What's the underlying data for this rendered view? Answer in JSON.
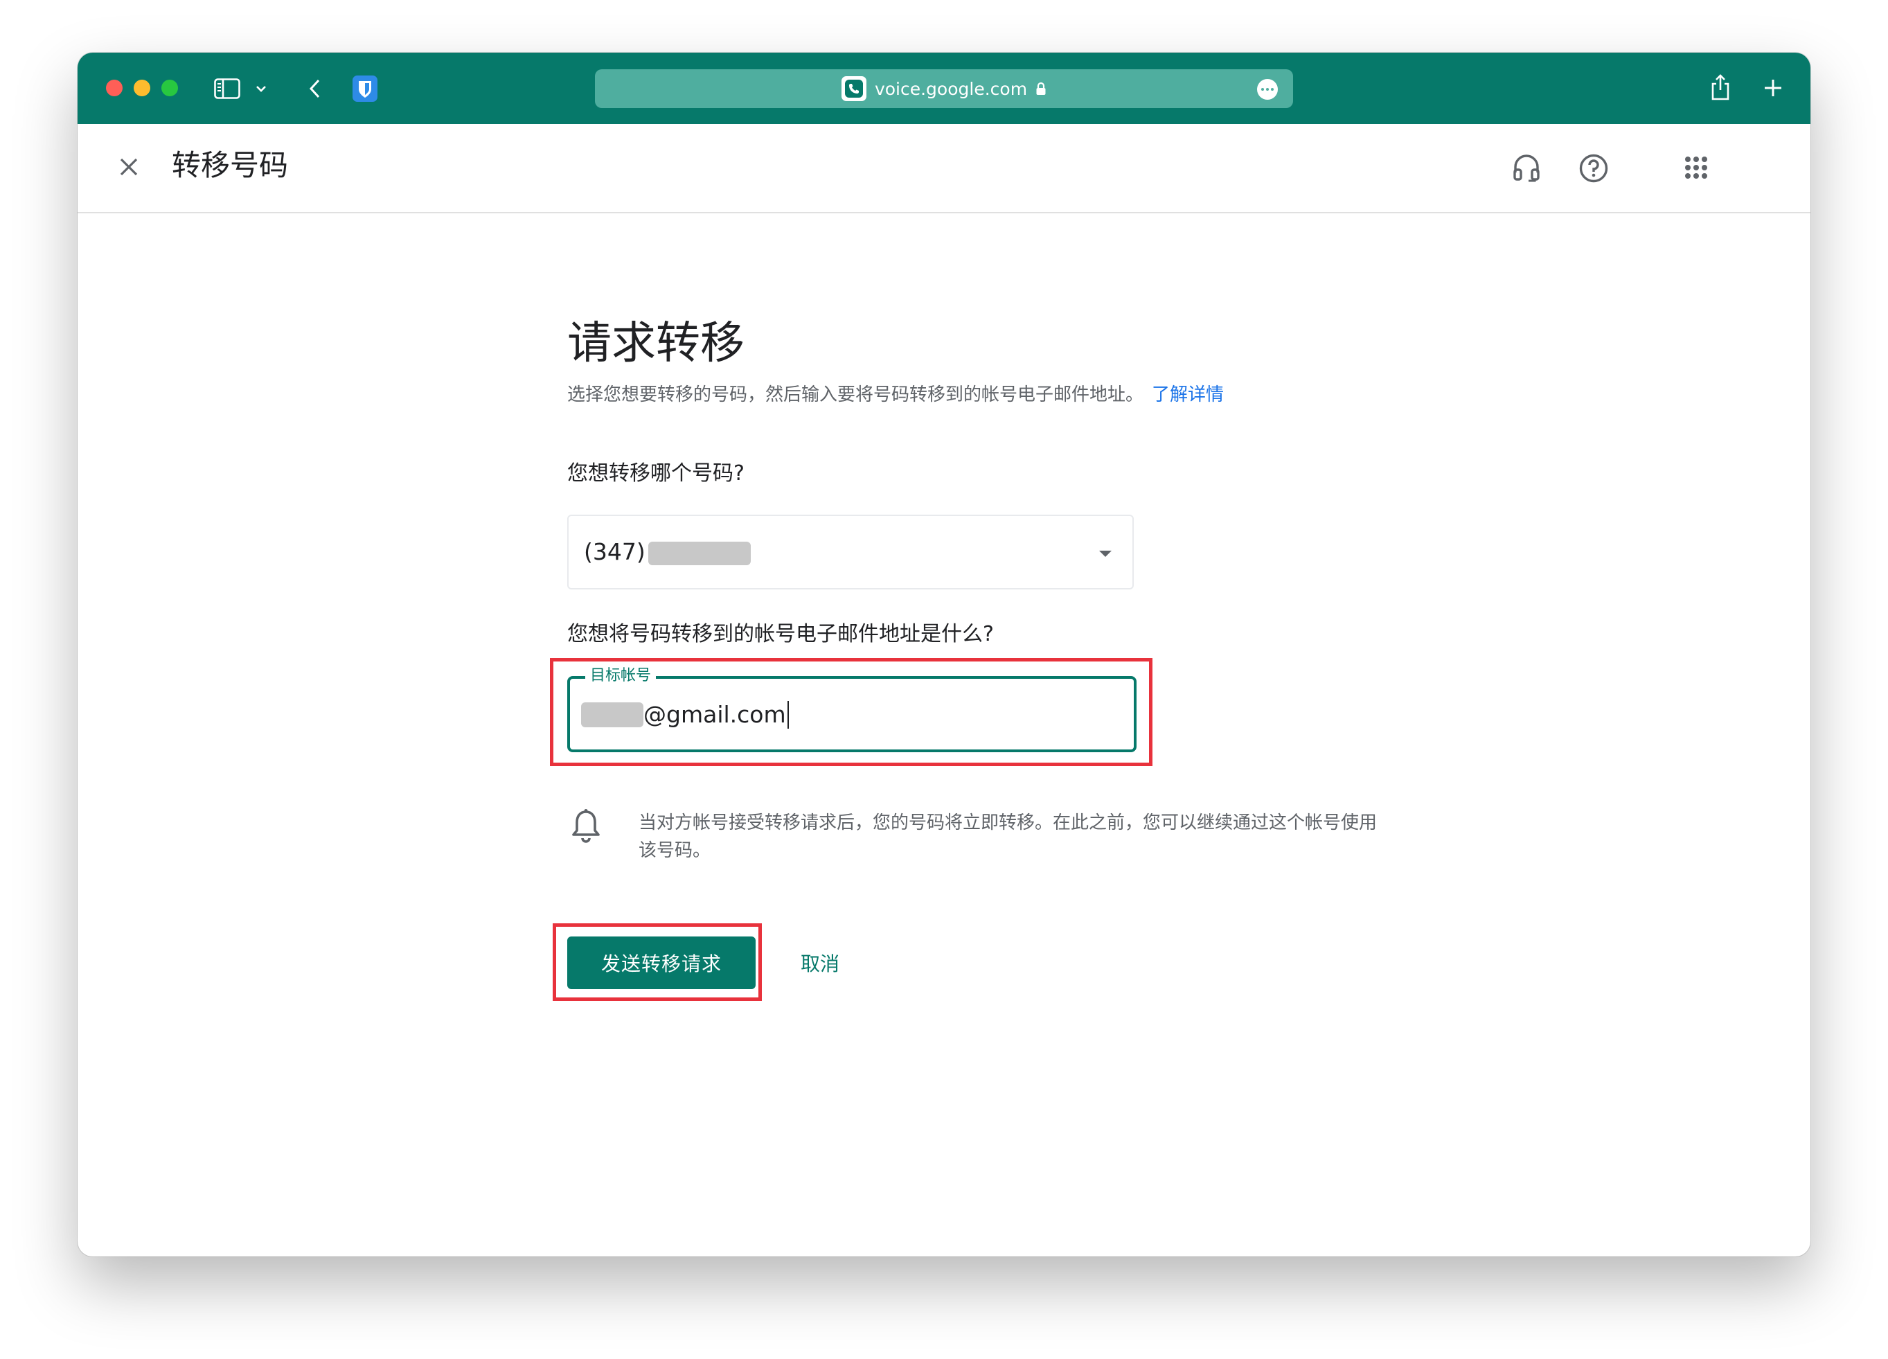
{
  "browser": {
    "url": "voice.google.com",
    "icons": [
      "sidebar-icon",
      "chevron-down-icon",
      "back-icon",
      "bitwarden-icon",
      "lock-icon",
      "more-icon",
      "share-icon",
      "new-tab-icon"
    ]
  },
  "app": {
    "title": "转移号码",
    "icons": [
      "close-icon",
      "support-icon",
      "help-icon",
      "apps-icon"
    ]
  },
  "page": {
    "heading": "请求转移",
    "subtitle": "选择您想要转移的号码，然后输入要将号码转移到的帐号电子邮件地址。",
    "learn_more": "了解详情",
    "number_question": "您想转移哪个号码?",
    "selected_number_prefix": "(347)",
    "email_question": "您想将号码转移到的帐号电子邮件地址是什么?",
    "email_label": "目标帐号",
    "email_suffix": "@gmail.com",
    "notice": "当对方帐号接受转移请求后，您的号码将立即转移。在此之前，您可以继续通过这个帐号使用该号码。",
    "submit_label": "发送转移请求",
    "cancel_label": "取消"
  },
  "colors": {
    "brand": "#06796a",
    "link": "#1a73e8",
    "highlight": "#e8323c"
  }
}
